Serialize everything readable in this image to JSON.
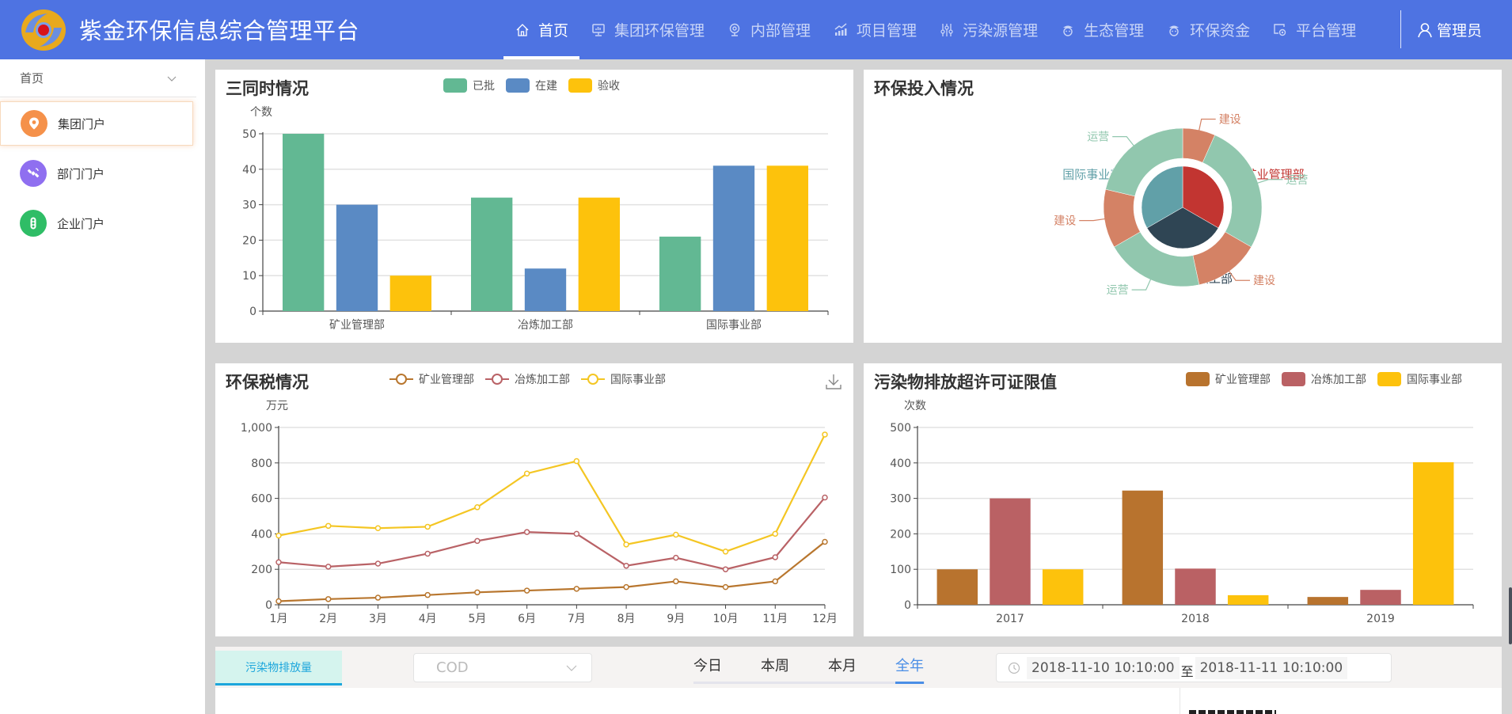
{
  "header": {
    "title": "紫金环保信息综合管理平台",
    "nav": [
      {
        "label": "首页",
        "icon": "home-icon",
        "active": true
      },
      {
        "label": "集团环保管理",
        "icon": "monitor-icon",
        "active": false
      },
      {
        "label": "内部管理",
        "icon": "webcam-icon",
        "active": false
      },
      {
        "label": "项目管理",
        "icon": "bar-trend-icon",
        "active": false
      },
      {
        "label": "污染源管理",
        "icon": "sliders-icon",
        "active": false
      },
      {
        "label": "生态管理",
        "icon": "officer-icon",
        "active": false
      },
      {
        "label": "环保资金",
        "icon": "officer-icon",
        "active": false
      },
      {
        "label": "平台管理",
        "icon": "screen-gear-icon",
        "active": false
      }
    ],
    "user": "管理员",
    "bg_color": "#4e73e2"
  },
  "sidebar": {
    "header": "首页",
    "items": [
      {
        "label": "集团门户",
        "icon": "location-pin-icon",
        "color": "#f5914a",
        "active": true
      },
      {
        "label": "部门门户",
        "icon": "satellite-icon",
        "color": "#8f6ff0",
        "active": false
      },
      {
        "label": "企业门户",
        "icon": "traffic-light-icon",
        "color": "#2fbd66",
        "active": false
      }
    ]
  },
  "panels": {
    "three_simultaneous": {
      "title": "三同时情况"
    },
    "investment": {
      "title": "环保投入情况"
    },
    "tax": {
      "title": "环保税情况"
    },
    "exceed": {
      "title": "污染物排放超许可证限值"
    }
  },
  "chart_data": [
    {
      "id": "three_simultaneous",
      "type": "bar",
      "title": "三同时情况",
      "categories": [
        "矿业管理部",
        "冶炼加工部",
        "国际事业部"
      ],
      "series": [
        {
          "name": "已批",
          "color": "#62b893",
          "values": [
            50,
            32,
            21
          ]
        },
        {
          "name": "在建",
          "color": "#5a8ac4",
          "values": [
            30,
            12,
            41
          ]
        },
        {
          "name": "验收",
          "color": "#fdc20c",
          "values": [
            10,
            32,
            41
          ]
        }
      ],
      "xlabel": "",
      "ylabel": "个数",
      "ylim": [
        0,
        50
      ],
      "yticks": [
        0,
        10,
        20,
        30,
        40,
        50
      ],
      "grid": true,
      "legend": "top-center"
    },
    {
      "id": "investment",
      "type": "pie",
      "title": "环保投入情况",
      "inner": [
        {
          "name": "矿业管理部",
          "value": 1,
          "color": "#c23531"
        },
        {
          "name": "冶炼加工部",
          "value": 1,
          "color": "#2f4554"
        },
        {
          "name": "国际事业部",
          "value": 1,
          "color": "#61a0a8"
        }
      ],
      "outer": [
        {
          "name": "建设",
          "parent": "矿业管理部",
          "value": 20,
          "color": "#d48265"
        },
        {
          "name": "运营",
          "parent": "矿业管理部",
          "value": 80,
          "color": "#91c7ae"
        },
        {
          "name": "建设",
          "parent": "冶炼加工部",
          "value": 40,
          "color": "#d48265"
        },
        {
          "name": "运营",
          "parent": "冶炼加工部",
          "value": 60,
          "color": "#91c7ae"
        },
        {
          "name": "建设",
          "parent": "国际事业部",
          "value": 36,
          "color": "#d48265"
        },
        {
          "name": "运营",
          "parent": "国际事业部",
          "value": 64,
          "color": "#91c7ae"
        }
      ]
    },
    {
      "id": "tax",
      "type": "line",
      "title": "环保税情况",
      "x": [
        "1月",
        "2月",
        "3月",
        "4月",
        "5月",
        "6月",
        "7月",
        "8月",
        "9月",
        "10月",
        "11月",
        "12月"
      ],
      "series": [
        {
          "name": "矿业管理部",
          "color": "#b8762e",
          "values": [
            20,
            32,
            40,
            55,
            70,
            80,
            90,
            100,
            132,
            100,
            132,
            355
          ]
        },
        {
          "name": "冶炼加工部",
          "color": "#b96266",
          "values": [
            240,
            215,
            232,
            288,
            360,
            410,
            400,
            220,
            265,
            200,
            268,
            605
          ]
        },
        {
          "name": "国际事业部",
          "color": "#f4c623",
          "values": [
            390,
            445,
            432,
            440,
            550,
            740,
            810,
            340,
            395,
            300,
            400,
            960
          ]
        }
      ],
      "xlabel": "",
      "ylabel": "万元",
      "ylim": [
        0,
        1000
      ],
      "yticks": [
        "0",
        "200",
        "400",
        "600",
        "800",
        "1,000"
      ],
      "grid": true,
      "legend": "top-center"
    },
    {
      "id": "exceed",
      "type": "bar",
      "title": "污染物排放超许可证限值",
      "categories": [
        "2017",
        "2018",
        "2019"
      ],
      "series": [
        {
          "name": "矿业管理部",
          "color": "#b8732e",
          "values": [
            100,
            322,
            22
          ]
        },
        {
          "name": "冶炼加工部",
          "color": "#ba6164",
          "values": [
            300,
            102,
            42
          ]
        },
        {
          "name": "国际事业部",
          "color": "#fdc20c",
          "values": [
            100,
            27,
            402
          ]
        }
      ],
      "xlabel": "",
      "ylabel": "次数",
      "ylim": [
        0,
        500
      ],
      "yticks": [
        0,
        100,
        200,
        300,
        400,
        500
      ],
      "grid": true,
      "legend": "top-right"
    }
  ],
  "bottom": {
    "tab_label": "污染物排放量",
    "select_value": "COD",
    "period_tabs": [
      {
        "label": "今日",
        "active": false
      },
      {
        "label": "本周",
        "active": false
      },
      {
        "label": "本月",
        "active": false
      },
      {
        "label": "全年",
        "active": true
      }
    ],
    "date_start": "2018-11-10 10:10:00",
    "date_sep": "至",
    "date_end": "2018-11-11 10:10:00"
  }
}
